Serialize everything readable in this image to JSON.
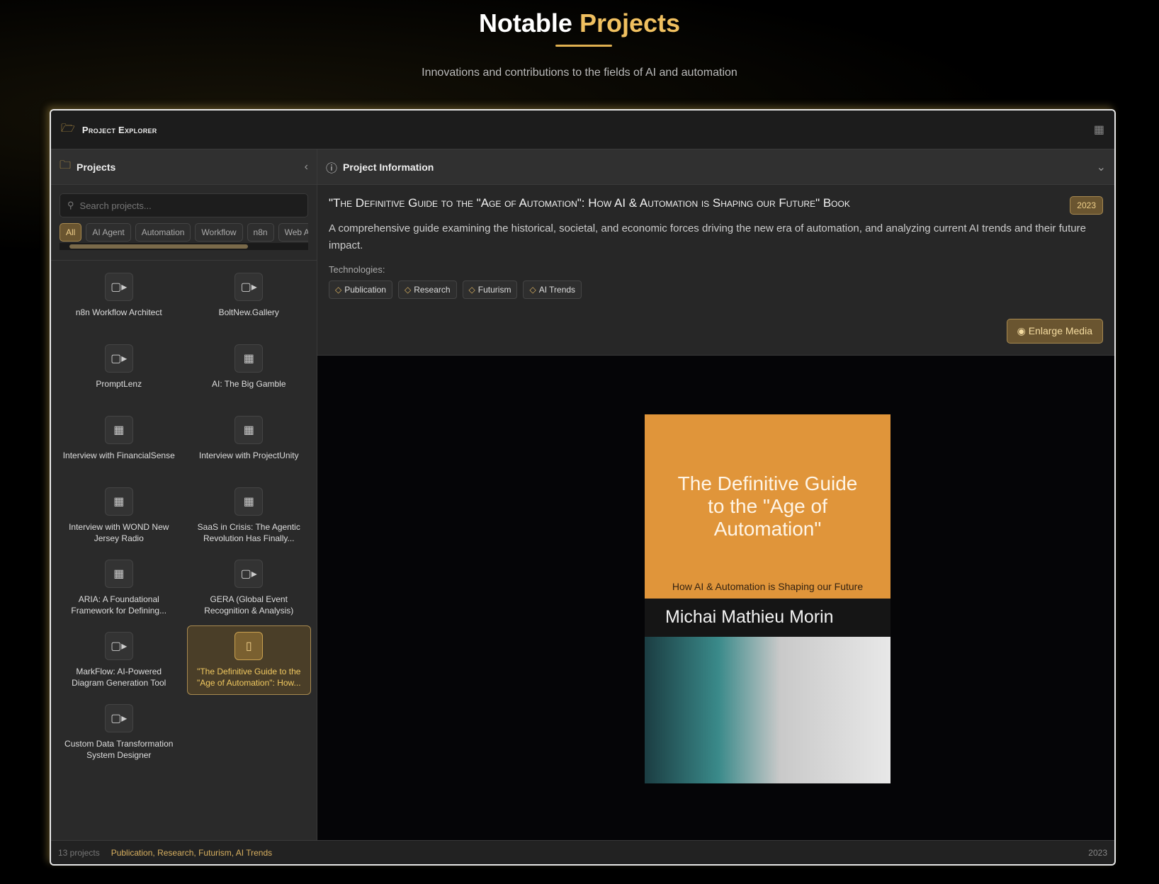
{
  "hero": {
    "title_a": "Notable",
    "title_b": "Projects",
    "subtitle": "Innovations and contributions to the fields of AI and automation"
  },
  "explorer": {
    "title": "Project Explorer"
  },
  "sidebar": {
    "title": "Projects",
    "search_placeholder": "Search projects...",
    "filters": [
      "All",
      "AI Agent",
      "Automation",
      "Workflow",
      "n8n",
      "Web Ap"
    ],
    "items": [
      {
        "label": "n8n Workflow Architect",
        "icon": "video-icon"
      },
      {
        "label": "BoltNew.Gallery",
        "icon": "video-icon"
      },
      {
        "label": "PromptLenz",
        "icon": "video-icon"
      },
      {
        "label": "AI: The Big Gamble",
        "icon": "image-icon"
      },
      {
        "label": "Interview with FinancialSense",
        "icon": "image-icon"
      },
      {
        "label": "Interview with ProjectUnity",
        "icon": "image-icon"
      },
      {
        "label": "Interview with WOND New Jersey Radio",
        "icon": "image-icon"
      },
      {
        "label": "SaaS in Crisis: The Agentic Revolution Has Finally...",
        "icon": "image-icon"
      },
      {
        "label": "ARIA: A Foundational Framework for Defining...",
        "icon": "image-icon"
      },
      {
        "label": "GERA (Global Event Recognition & Analysis)",
        "icon": "video-icon"
      },
      {
        "label": "MarkFlow: AI-Powered Diagram Generation Tool",
        "icon": "video-icon"
      },
      {
        "label": "\"The Definitive Guide to the \"Age of Automation\": How...",
        "icon": "book-icon"
      },
      {
        "label": "Custom Data Transformation System Designer",
        "icon": "video-icon"
      }
    ]
  },
  "info": {
    "header": "Project Information",
    "title": "\"The Definitive Guide to the \"Age of Automation\": How AI & Automation is Shaping our Future\" Book",
    "year": "2023",
    "description": "A comprehensive guide examining the historical, societal, and economic forces driving the new era of automation, and analyzing current AI trends and their future impact.",
    "tech_label": "Technologies:",
    "tags": [
      "Publication",
      "Research",
      "Futurism",
      "AI Trends"
    ],
    "enlarge": "Enlarge Media"
  },
  "book": {
    "title": "The Definitive Guide to the \"Age of Automation\"",
    "subtitle": "How AI & Automation is Shaping our Future",
    "author": "Michai Mathieu Morin"
  },
  "footer": {
    "count": "13 projects",
    "tags": "Publication, Research, Futurism, AI Trends",
    "year": "2023"
  },
  "colors": {
    "accent": "#f0c060"
  }
}
